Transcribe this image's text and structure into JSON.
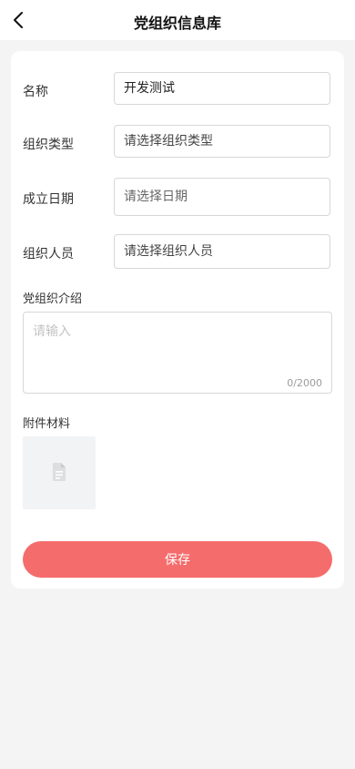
{
  "header": {
    "title": "党组织信息库"
  },
  "form": {
    "name": {
      "label": "名称",
      "value": "开发测试"
    },
    "org_type": {
      "label": "组织类型",
      "placeholder": "请选择组织类型"
    },
    "established_date": {
      "label": "成立日期",
      "placeholder": "请选择日期"
    },
    "members": {
      "label": "组织人员",
      "placeholder": "请选择组织人员"
    },
    "intro": {
      "label": "党组织介绍",
      "placeholder": "请输入",
      "counter": "0/2000"
    },
    "attachments": {
      "label": "附件材料",
      "icon": "file-icon"
    },
    "save_label": "保存"
  },
  "colors": {
    "primary_button": "#f56c6c",
    "page_bg": "#f4f4f4"
  }
}
